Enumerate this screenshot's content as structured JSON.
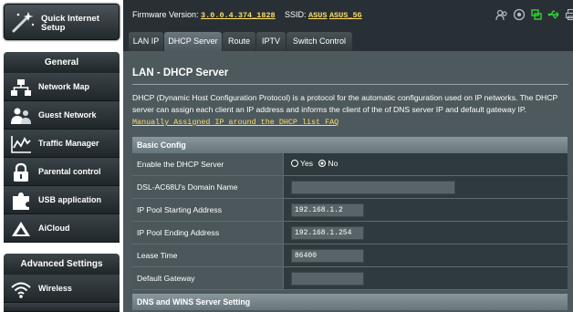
{
  "sidebar": {
    "quick_setup_label": "Quick Internet Setup",
    "general_header": "General",
    "general_items": [
      {
        "label": "Network Map",
        "icon": "network-map-icon"
      },
      {
        "label": "Guest Network",
        "icon": "guest-network-icon"
      },
      {
        "label": "Traffic Manager",
        "icon": "traffic-manager-icon"
      },
      {
        "label": "Parental control",
        "icon": "parental-control-icon"
      },
      {
        "label": "USB application",
        "icon": "usb-application-icon"
      },
      {
        "label": "AiCloud",
        "icon": "aicloud-icon"
      }
    ],
    "advanced_header": "Advanced Settings",
    "advanced_items": [
      {
        "label": "Wireless",
        "icon": "wireless-icon"
      }
    ]
  },
  "topbar": {
    "firmware_label": "Firmware Version:",
    "firmware_value": "3.0.0.4.374_1828",
    "ssid_label": "SSID:",
    "ssid_values": [
      "ASUS",
      "ASUS_5G"
    ]
  },
  "tabs": [
    "LAN IP",
    "DHCP Server",
    "Route",
    "IPTV",
    "Switch Control"
  ],
  "active_tab": "DHCP Server",
  "page": {
    "title": "LAN - DHCP Server",
    "description": "DHCP (Dynamic Host Configuration Protocol) is a protocol for the automatic configuration used on IP networks. The DHCP server can assign each client an IP address and informs the client of the of DNS server IP and default gateway IP.",
    "faq_link": "Manually Assigned IP around the DHCP list FAQ"
  },
  "basic_config": {
    "header": "Basic Config",
    "enable_label": "Enable the DHCP Server",
    "enable_options": [
      "Yes",
      "No"
    ],
    "enable_selected": "No",
    "domain_label": "DSL-AC68U's Domain Name",
    "domain_value": "",
    "start_label": "IP Pool Starting Address",
    "start_value": "192.168.1.2",
    "end_label": "IP Pool Ending Address",
    "end_value": "192.168.1.254",
    "lease_label": "Lease Time",
    "lease_value": "86400",
    "gateway_label": "Default Gateway",
    "gateway_value": ""
  },
  "dns_section": {
    "header": "DNS and WINS Server Setting"
  },
  "colors": {
    "accent_link": "#ffdd66",
    "panel_bg": "#4d595d",
    "topbar_bg": "#283035"
  }
}
